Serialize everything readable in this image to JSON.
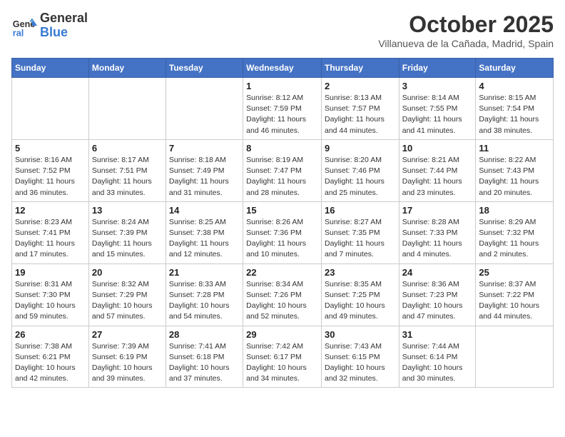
{
  "header": {
    "logo": {
      "general": "General",
      "blue": "Blue"
    },
    "title": "October 2025",
    "location": "Villanueva de la Cañada, Madrid, Spain"
  },
  "weekdays": [
    "Sunday",
    "Monday",
    "Tuesday",
    "Wednesday",
    "Thursday",
    "Friday",
    "Saturday"
  ],
  "weeks": [
    [
      null,
      null,
      null,
      {
        "day": "1",
        "sunrise": "Sunrise: 8:12 AM",
        "sunset": "Sunset: 7:59 PM",
        "daylight": "Daylight: 11 hours and 46 minutes."
      },
      {
        "day": "2",
        "sunrise": "Sunrise: 8:13 AM",
        "sunset": "Sunset: 7:57 PM",
        "daylight": "Daylight: 11 hours and 44 minutes."
      },
      {
        "day": "3",
        "sunrise": "Sunrise: 8:14 AM",
        "sunset": "Sunset: 7:55 PM",
        "daylight": "Daylight: 11 hours and 41 minutes."
      },
      {
        "day": "4",
        "sunrise": "Sunrise: 8:15 AM",
        "sunset": "Sunset: 7:54 PM",
        "daylight": "Daylight: 11 hours and 38 minutes."
      }
    ],
    [
      {
        "day": "5",
        "sunrise": "Sunrise: 8:16 AM",
        "sunset": "Sunset: 7:52 PM",
        "daylight": "Daylight: 11 hours and 36 minutes."
      },
      {
        "day": "6",
        "sunrise": "Sunrise: 8:17 AM",
        "sunset": "Sunset: 7:51 PM",
        "daylight": "Daylight: 11 hours and 33 minutes."
      },
      {
        "day": "7",
        "sunrise": "Sunrise: 8:18 AM",
        "sunset": "Sunset: 7:49 PM",
        "daylight": "Daylight: 11 hours and 31 minutes."
      },
      {
        "day": "8",
        "sunrise": "Sunrise: 8:19 AM",
        "sunset": "Sunset: 7:47 PM",
        "daylight": "Daylight: 11 hours and 28 minutes."
      },
      {
        "day": "9",
        "sunrise": "Sunrise: 8:20 AM",
        "sunset": "Sunset: 7:46 PM",
        "daylight": "Daylight: 11 hours and 25 minutes."
      },
      {
        "day": "10",
        "sunrise": "Sunrise: 8:21 AM",
        "sunset": "Sunset: 7:44 PM",
        "daylight": "Daylight: 11 hours and 23 minutes."
      },
      {
        "day": "11",
        "sunrise": "Sunrise: 8:22 AM",
        "sunset": "Sunset: 7:43 PM",
        "daylight": "Daylight: 11 hours and 20 minutes."
      }
    ],
    [
      {
        "day": "12",
        "sunrise": "Sunrise: 8:23 AM",
        "sunset": "Sunset: 7:41 PM",
        "daylight": "Daylight: 11 hours and 17 minutes."
      },
      {
        "day": "13",
        "sunrise": "Sunrise: 8:24 AM",
        "sunset": "Sunset: 7:39 PM",
        "daylight": "Daylight: 11 hours and 15 minutes."
      },
      {
        "day": "14",
        "sunrise": "Sunrise: 8:25 AM",
        "sunset": "Sunset: 7:38 PM",
        "daylight": "Daylight: 11 hours and 12 minutes."
      },
      {
        "day": "15",
        "sunrise": "Sunrise: 8:26 AM",
        "sunset": "Sunset: 7:36 PM",
        "daylight": "Daylight: 11 hours and 10 minutes."
      },
      {
        "day": "16",
        "sunrise": "Sunrise: 8:27 AM",
        "sunset": "Sunset: 7:35 PM",
        "daylight": "Daylight: 11 hours and 7 minutes."
      },
      {
        "day": "17",
        "sunrise": "Sunrise: 8:28 AM",
        "sunset": "Sunset: 7:33 PM",
        "daylight": "Daylight: 11 hours and 4 minutes."
      },
      {
        "day": "18",
        "sunrise": "Sunrise: 8:29 AM",
        "sunset": "Sunset: 7:32 PM",
        "daylight": "Daylight: 11 hours and 2 minutes."
      }
    ],
    [
      {
        "day": "19",
        "sunrise": "Sunrise: 8:31 AM",
        "sunset": "Sunset: 7:30 PM",
        "daylight": "Daylight: 10 hours and 59 minutes."
      },
      {
        "day": "20",
        "sunrise": "Sunrise: 8:32 AM",
        "sunset": "Sunset: 7:29 PM",
        "daylight": "Daylight: 10 hours and 57 minutes."
      },
      {
        "day": "21",
        "sunrise": "Sunrise: 8:33 AM",
        "sunset": "Sunset: 7:28 PM",
        "daylight": "Daylight: 10 hours and 54 minutes."
      },
      {
        "day": "22",
        "sunrise": "Sunrise: 8:34 AM",
        "sunset": "Sunset: 7:26 PM",
        "daylight": "Daylight: 10 hours and 52 minutes."
      },
      {
        "day": "23",
        "sunrise": "Sunrise: 8:35 AM",
        "sunset": "Sunset: 7:25 PM",
        "daylight": "Daylight: 10 hours and 49 minutes."
      },
      {
        "day": "24",
        "sunrise": "Sunrise: 8:36 AM",
        "sunset": "Sunset: 7:23 PM",
        "daylight": "Daylight: 10 hours and 47 minutes."
      },
      {
        "day": "25",
        "sunrise": "Sunrise: 8:37 AM",
        "sunset": "Sunset: 7:22 PM",
        "daylight": "Daylight: 10 hours and 44 minutes."
      }
    ],
    [
      {
        "day": "26",
        "sunrise": "Sunrise: 7:38 AM",
        "sunset": "Sunset: 6:21 PM",
        "daylight": "Daylight: 10 hours and 42 minutes."
      },
      {
        "day": "27",
        "sunrise": "Sunrise: 7:39 AM",
        "sunset": "Sunset: 6:19 PM",
        "daylight": "Daylight: 10 hours and 39 minutes."
      },
      {
        "day": "28",
        "sunrise": "Sunrise: 7:41 AM",
        "sunset": "Sunset: 6:18 PM",
        "daylight": "Daylight: 10 hours and 37 minutes."
      },
      {
        "day": "29",
        "sunrise": "Sunrise: 7:42 AM",
        "sunset": "Sunset: 6:17 PM",
        "daylight": "Daylight: 10 hours and 34 minutes."
      },
      {
        "day": "30",
        "sunrise": "Sunrise: 7:43 AM",
        "sunset": "Sunset: 6:15 PM",
        "daylight": "Daylight: 10 hours and 32 minutes."
      },
      {
        "day": "31",
        "sunrise": "Sunrise: 7:44 AM",
        "sunset": "Sunset: 6:14 PM",
        "daylight": "Daylight: 10 hours and 30 minutes."
      },
      null
    ]
  ]
}
